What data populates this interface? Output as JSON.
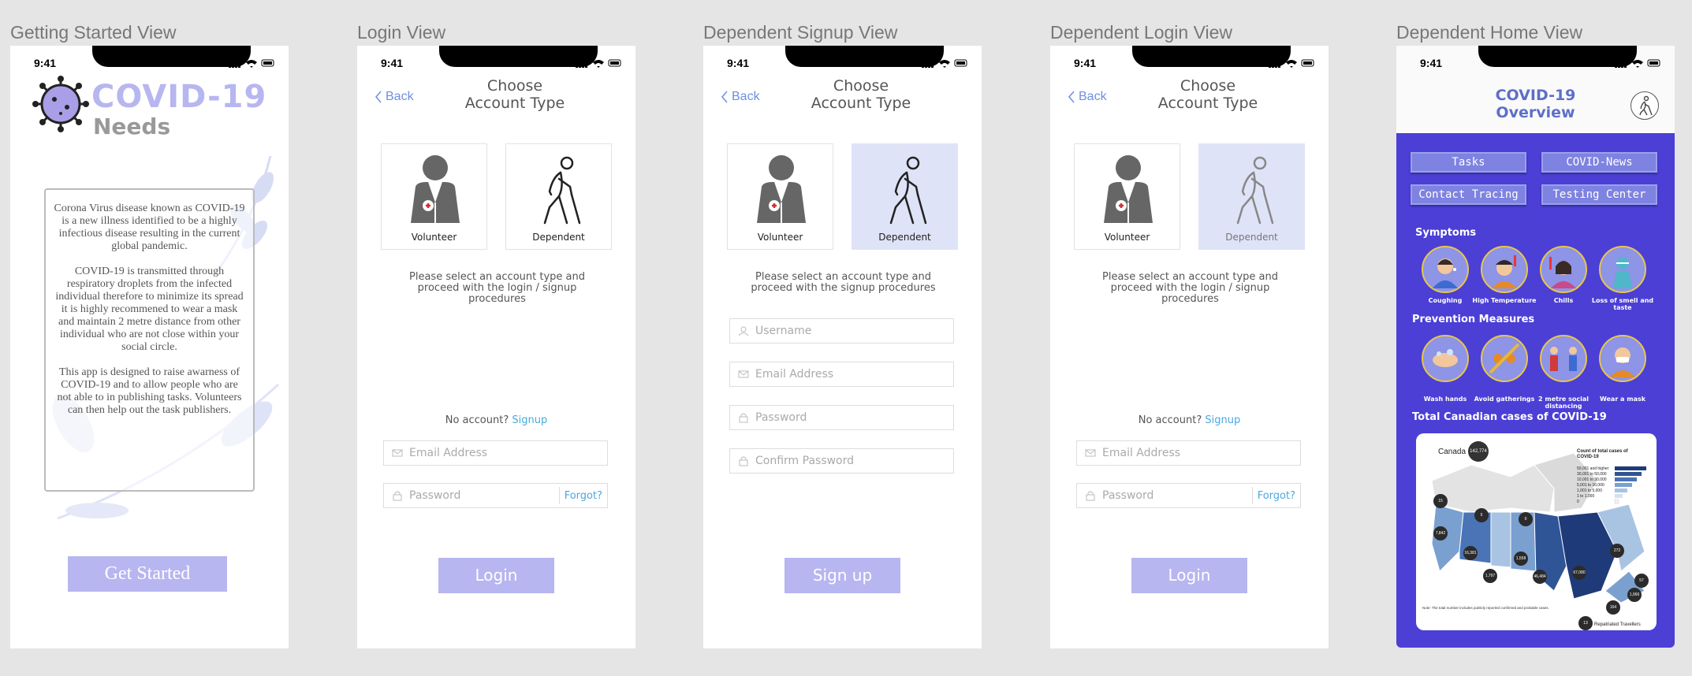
{
  "frames": {
    "getting_started": "Getting Started View",
    "login": "Login View",
    "dep_signup": "Dependent Signup View",
    "dep_login": "Dependent Login View",
    "dep_home": "Dependent Home View"
  },
  "status_time": "9:41",
  "common": {
    "back": "Back",
    "choose_line1": "Choose",
    "choose_line2": "Account Type",
    "volunteer": "Volunteer",
    "dependent": "Dependent",
    "desc_login": "Please select an account type and proceed with the login / signup procedures",
    "desc_signup": "Please select an account type and proceed with the signup procedures",
    "no_account": "No account?",
    "signup_link": "Signup",
    "email_ph": "Email Address",
    "password_ph": "Password",
    "forgot": "Forgot?",
    "username_ph": "Username",
    "confirm_ph": "Confirm Password",
    "login_btn": "Login",
    "signup_btn": "Sign up"
  },
  "getting_started": {
    "logo_title": "COVID-19",
    "logo_sub": "Needs",
    "para1": "Corona Virus disease known as COVID-19 is a new illness identified to be a highly infectious disease resulting in the current global pandemic.",
    "para2": "COVID-19 is transmitted through respiratory droplets from the infected individual therefore to minimize its spread it is highly recommened to wear a mask and maintain 2 metre distance from other individual who are not close within your social circle.",
    "para3": "This app is designed to raise awarness of COVID-19 and to allow people who are not able to in publishing tasks. Volunteers can then help out the task publishers.",
    "button": "Get Started"
  },
  "home": {
    "title1": "COVID-19",
    "title2": "Overview",
    "buttons": [
      "Tasks",
      "COVID-News",
      "Contact Tracing",
      "Testing Center"
    ],
    "symptoms_title": "Symptoms",
    "symptoms": [
      "Coughing",
      "High Temperature",
      "Chills",
      "Loss of smell and taste"
    ],
    "prevention_title": "Prevention Measures",
    "prevention": [
      "Wash hands",
      "Avoid gatherings",
      "2 metre social distancing",
      "Wear a mask"
    ],
    "cases_title": "Total Canadian cases of COVID-19",
    "map": {
      "canada": "Canada",
      "canada_total": "142,774",
      "legend_title": "Count of total cases of COVID-19",
      "legend": [
        "50,001 and higher",
        "30,001 to 50,000",
        "10,001 to 30,000",
        "5,001 to 10,000",
        "1,001 to 5,000",
        "1 to 1,000",
        "0"
      ],
      "legend_colors": [
        "#1f3a78",
        "#2f5597",
        "#4a74b5",
        "#7aa0d0",
        "#a9c3e3",
        "#d3e1f1",
        "#f2f2f2"
      ],
      "bubbles": [
        "15",
        "5",
        "0",
        "7,842",
        "16,381",
        "1,797",
        "1,558",
        "46,484",
        "67,080",
        "272",
        "57",
        "1,066",
        "164",
        "13"
      ],
      "note": "Note: The total number includes publicly reported confirmed and probable cases.",
      "footer": "Repatriated Travellers"
    }
  },
  "colors": {
    "accent": "#b7b6f0",
    "selected": "#dfe3f7",
    "home_bg": "#4b3fd6",
    "link": "#4aa8e0",
    "title_blue": "#5d6fc7"
  }
}
